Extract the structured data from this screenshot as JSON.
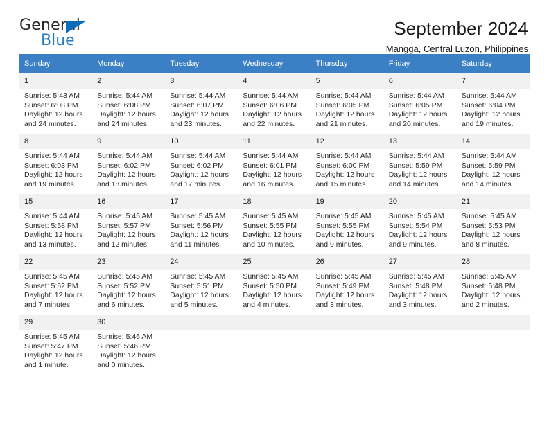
{
  "brand": {
    "name_top": "General",
    "name_bottom": "Blue",
    "accent_color": "#1f7bc4",
    "triangle_color": "#0d6cb9"
  },
  "header": {
    "title": "September 2024",
    "subtitle": "Mangga, Central Luzon, Philippines"
  },
  "theme": {
    "header_row_bg": "#3b7fc4",
    "daynum_bg": "#f1f1f1",
    "grid_line": "#3b7fc4"
  },
  "weekday_headers": [
    "Sunday",
    "Monday",
    "Tuesday",
    "Wednesday",
    "Thursday",
    "Friday",
    "Saturday"
  ],
  "labels": {
    "sunrise": "Sunrise:",
    "sunset": "Sunset:",
    "daylight": "Daylight:"
  },
  "weeks": [
    [
      {
        "day": "1",
        "sunrise": "Sunrise: 5:43 AM",
        "sunset": "Sunset: 6:08 PM",
        "daylight1": "Daylight: 12 hours",
        "daylight2": "and 24 minutes."
      },
      {
        "day": "2",
        "sunrise": "Sunrise: 5:44 AM",
        "sunset": "Sunset: 6:08 PM",
        "daylight1": "Daylight: 12 hours",
        "daylight2": "and 24 minutes."
      },
      {
        "day": "3",
        "sunrise": "Sunrise: 5:44 AM",
        "sunset": "Sunset: 6:07 PM",
        "daylight1": "Daylight: 12 hours",
        "daylight2": "and 23 minutes."
      },
      {
        "day": "4",
        "sunrise": "Sunrise: 5:44 AM",
        "sunset": "Sunset: 6:06 PM",
        "daylight1": "Daylight: 12 hours",
        "daylight2": "and 22 minutes."
      },
      {
        "day": "5",
        "sunrise": "Sunrise: 5:44 AM",
        "sunset": "Sunset: 6:05 PM",
        "daylight1": "Daylight: 12 hours",
        "daylight2": "and 21 minutes."
      },
      {
        "day": "6",
        "sunrise": "Sunrise: 5:44 AM",
        "sunset": "Sunset: 6:05 PM",
        "daylight1": "Daylight: 12 hours",
        "daylight2": "and 20 minutes."
      },
      {
        "day": "7",
        "sunrise": "Sunrise: 5:44 AM",
        "sunset": "Sunset: 6:04 PM",
        "daylight1": "Daylight: 12 hours",
        "daylight2": "and 19 minutes."
      }
    ],
    [
      {
        "day": "8",
        "sunrise": "Sunrise: 5:44 AM",
        "sunset": "Sunset: 6:03 PM",
        "daylight1": "Daylight: 12 hours",
        "daylight2": "and 19 minutes."
      },
      {
        "day": "9",
        "sunrise": "Sunrise: 5:44 AM",
        "sunset": "Sunset: 6:02 PM",
        "daylight1": "Daylight: 12 hours",
        "daylight2": "and 18 minutes."
      },
      {
        "day": "10",
        "sunrise": "Sunrise: 5:44 AM",
        "sunset": "Sunset: 6:02 PM",
        "daylight1": "Daylight: 12 hours",
        "daylight2": "and 17 minutes."
      },
      {
        "day": "11",
        "sunrise": "Sunrise: 5:44 AM",
        "sunset": "Sunset: 6:01 PM",
        "daylight1": "Daylight: 12 hours",
        "daylight2": "and 16 minutes."
      },
      {
        "day": "12",
        "sunrise": "Sunrise: 5:44 AM",
        "sunset": "Sunset: 6:00 PM",
        "daylight1": "Daylight: 12 hours",
        "daylight2": "and 15 minutes."
      },
      {
        "day": "13",
        "sunrise": "Sunrise: 5:44 AM",
        "sunset": "Sunset: 5:59 PM",
        "daylight1": "Daylight: 12 hours",
        "daylight2": "and 14 minutes."
      },
      {
        "day": "14",
        "sunrise": "Sunrise: 5:44 AM",
        "sunset": "Sunset: 5:59 PM",
        "daylight1": "Daylight: 12 hours",
        "daylight2": "and 14 minutes."
      }
    ],
    [
      {
        "day": "15",
        "sunrise": "Sunrise: 5:44 AM",
        "sunset": "Sunset: 5:58 PM",
        "daylight1": "Daylight: 12 hours",
        "daylight2": "and 13 minutes."
      },
      {
        "day": "16",
        "sunrise": "Sunrise: 5:45 AM",
        "sunset": "Sunset: 5:57 PM",
        "daylight1": "Daylight: 12 hours",
        "daylight2": "and 12 minutes."
      },
      {
        "day": "17",
        "sunrise": "Sunrise: 5:45 AM",
        "sunset": "Sunset: 5:56 PM",
        "daylight1": "Daylight: 12 hours",
        "daylight2": "and 11 minutes."
      },
      {
        "day": "18",
        "sunrise": "Sunrise: 5:45 AM",
        "sunset": "Sunset: 5:55 PM",
        "daylight1": "Daylight: 12 hours",
        "daylight2": "and 10 minutes."
      },
      {
        "day": "19",
        "sunrise": "Sunrise: 5:45 AM",
        "sunset": "Sunset: 5:55 PM",
        "daylight1": "Daylight: 12 hours",
        "daylight2": "and 9 minutes."
      },
      {
        "day": "20",
        "sunrise": "Sunrise: 5:45 AM",
        "sunset": "Sunset: 5:54 PM",
        "daylight1": "Daylight: 12 hours",
        "daylight2": "and 9 minutes."
      },
      {
        "day": "21",
        "sunrise": "Sunrise: 5:45 AM",
        "sunset": "Sunset: 5:53 PM",
        "daylight1": "Daylight: 12 hours",
        "daylight2": "and 8 minutes."
      }
    ],
    [
      {
        "day": "22",
        "sunrise": "Sunrise: 5:45 AM",
        "sunset": "Sunset: 5:52 PM",
        "daylight1": "Daylight: 12 hours",
        "daylight2": "and 7 minutes."
      },
      {
        "day": "23",
        "sunrise": "Sunrise: 5:45 AM",
        "sunset": "Sunset: 5:52 PM",
        "daylight1": "Daylight: 12 hours",
        "daylight2": "and 6 minutes."
      },
      {
        "day": "24",
        "sunrise": "Sunrise: 5:45 AM",
        "sunset": "Sunset: 5:51 PM",
        "daylight1": "Daylight: 12 hours",
        "daylight2": "and 5 minutes."
      },
      {
        "day": "25",
        "sunrise": "Sunrise: 5:45 AM",
        "sunset": "Sunset: 5:50 PM",
        "daylight1": "Daylight: 12 hours",
        "daylight2": "and 4 minutes."
      },
      {
        "day": "26",
        "sunrise": "Sunrise: 5:45 AM",
        "sunset": "Sunset: 5:49 PM",
        "daylight1": "Daylight: 12 hours",
        "daylight2": "and 3 minutes."
      },
      {
        "day": "27",
        "sunrise": "Sunrise: 5:45 AM",
        "sunset": "Sunset: 5:48 PM",
        "daylight1": "Daylight: 12 hours",
        "daylight2": "and 3 minutes."
      },
      {
        "day": "28",
        "sunrise": "Sunrise: 5:45 AM",
        "sunset": "Sunset: 5:48 PM",
        "daylight1": "Daylight: 12 hours",
        "daylight2": "and 2 minutes."
      }
    ],
    [
      {
        "day": "29",
        "sunrise": "Sunrise: 5:45 AM",
        "sunset": "Sunset: 5:47 PM",
        "daylight1": "Daylight: 12 hours",
        "daylight2": "and 1 minute."
      },
      {
        "day": "30",
        "sunrise": "Sunrise: 5:46 AM",
        "sunset": "Sunset: 5:46 PM",
        "daylight1": "Daylight: 12 hours",
        "daylight2": "and 0 minutes."
      },
      {
        "day": "",
        "sunrise": "",
        "sunset": "",
        "daylight1": "",
        "daylight2": ""
      },
      {
        "day": "",
        "sunrise": "",
        "sunset": "",
        "daylight1": "",
        "daylight2": ""
      },
      {
        "day": "",
        "sunrise": "",
        "sunset": "",
        "daylight1": "",
        "daylight2": ""
      },
      {
        "day": "",
        "sunrise": "",
        "sunset": "",
        "daylight1": "",
        "daylight2": ""
      },
      {
        "day": "",
        "sunrise": "",
        "sunset": "",
        "daylight1": "",
        "daylight2": ""
      }
    ]
  ]
}
